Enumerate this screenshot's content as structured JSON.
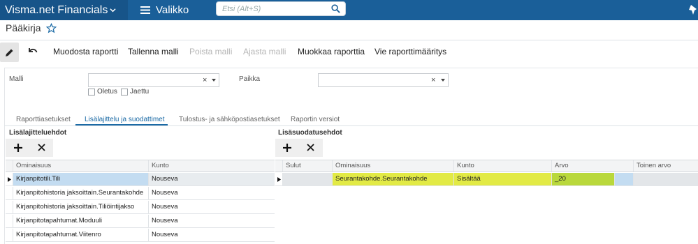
{
  "app": {
    "brand": "Visma.net Financials",
    "menu_label": "Valikko",
    "search_placeholder": "Etsi (Alt+S)"
  },
  "page": {
    "title": "Pääkirja"
  },
  "toolbar": {
    "create_report": "Muodosta raportti",
    "save_template": "Tallenna malli",
    "delete_template": "Poista malli",
    "run_template": "Ajasta malli",
    "edit_report": "Muokkaa raporttia",
    "export_definition": "Vie raporttimääritys"
  },
  "form": {
    "template_label": "Malli",
    "template_value": "",
    "default_label": "Oletus",
    "default_checked": false,
    "shared_label": "Jaettu",
    "shared_checked": false,
    "location_label": "Paikka",
    "location_value": "",
    "clear_glyph": "×"
  },
  "tabs": [
    {
      "label": "Raporttiasetukset",
      "active": false
    },
    {
      "label": "Lisälajittelu ja suodattimet",
      "active": true
    },
    {
      "label": "Tulostus- ja sähköpostiasetukset",
      "active": false
    },
    {
      "label": "Raportin versiot",
      "active": false
    }
  ],
  "sort_section": {
    "title": "Lisälajitteluehdot",
    "columns": [
      "Ominaisuus",
      "Kunto"
    ],
    "rows": [
      {
        "property": "Kirjanpitotili.Tili",
        "condition": "Nouseva",
        "selected": true
      },
      {
        "property": "Kirjanpitohistoria jaksoittain.Seurantakohde",
        "condition": "Nouseva",
        "selected": false
      },
      {
        "property": "Kirjanpitohistoria jaksoittain.Tiliöintijakso",
        "condition": "Nouseva",
        "selected": false
      },
      {
        "property": "Kirjanpitotapahtumat.Moduuli",
        "condition": "Nouseva",
        "selected": false
      },
      {
        "property": "Kirjanpitotapahtumat.Viitenro",
        "condition": "Nouseva",
        "selected": false
      }
    ]
  },
  "filter_section": {
    "title": "Lisäsuodatusehdot",
    "columns": [
      "Sulut",
      "Ominaisuus",
      "Kunto",
      "Arvo",
      "Toinen arvo"
    ],
    "rows": [
      {
        "brackets": "",
        "property": "Seurantakohde.Seurantakohde",
        "condition": "Sisältää",
        "value": "_20",
        "value2": ""
      }
    ]
  },
  "colors": {
    "topbar": "#1a5f99",
    "brand_bg": "#175489",
    "accent": "#1b6aa5",
    "selected_row": "#c3dcf1",
    "highlight": "#e2ea45",
    "highlight_value": "#b9d83c"
  },
  "icons": [
    "chevron-down-icon",
    "hamburger-icon",
    "search-icon",
    "pin-icon",
    "star-icon",
    "pencil-icon",
    "undo-icon",
    "plus-icon",
    "close-icon",
    "row-arrow-icon"
  ]
}
